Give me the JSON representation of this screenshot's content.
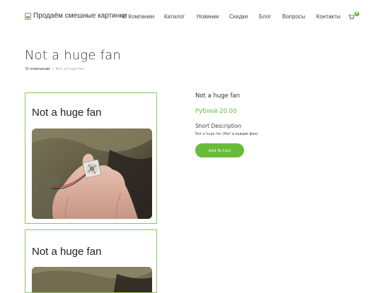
{
  "header": {
    "logo_text": "Продаём смешные картинки",
    "nav": [
      "О Компании",
      "Каталог",
      "Новинки",
      "Скидки",
      "Блог",
      "Вопросы",
      "Контакты"
    ],
    "cart_count": "0"
  },
  "page": {
    "title": "Not a huge fan",
    "breadcrumb": {
      "parent": "О компании",
      "separator": "/",
      "current": "Not a huge fan"
    }
  },
  "gallery": {
    "cards": [
      {
        "caption": "Not a huge fan"
      },
      {
        "caption": "Not a huge fan"
      }
    ]
  },
  "product": {
    "name": "Not a huge fan",
    "price": "Рублей 20.00",
    "short_desc_title": "Short Description",
    "short_desc_en": "Not a huge fan",
    "short_desc_ru": "(Нот а хьюдж фэн)",
    "add_to_cart": "Add To Cart"
  },
  "colors": {
    "accent": "#6abb3a",
    "card_border": "#8cc860"
  }
}
